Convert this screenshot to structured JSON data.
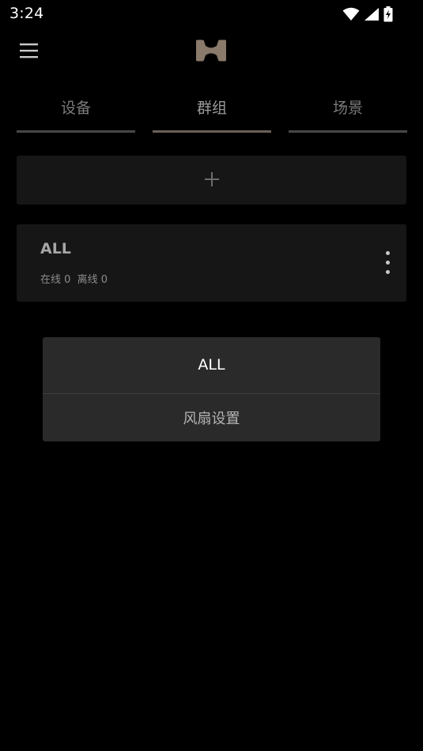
{
  "status_bar": {
    "time": "3:24",
    "icons": [
      "wifi-icon",
      "signal-icon",
      "battery-charging-icon"
    ]
  },
  "app_bar": {
    "menu_icon": "hamburger-menu-icon",
    "logo_icon": "brand-logo-icon",
    "logo_color": "#8a7a6b"
  },
  "tabs": [
    {
      "label": "设备",
      "active": false
    },
    {
      "label": "群组",
      "active": true
    },
    {
      "label": "场景",
      "active": false
    }
  ],
  "add_card": {
    "icon": "plus-icon"
  },
  "group_card": {
    "name": "ALL",
    "status": "在线 0  离线 0",
    "more_icon": "more-vertical-icon"
  },
  "popup_menu": {
    "title": "ALL",
    "items": [
      "风扇设置"
    ]
  },
  "colors": {
    "background": "#000000",
    "card": "#161616",
    "popup": "#2a2a2a",
    "tab_indicator": "#474747",
    "tab_indicator_active": "#6a5f57"
  }
}
